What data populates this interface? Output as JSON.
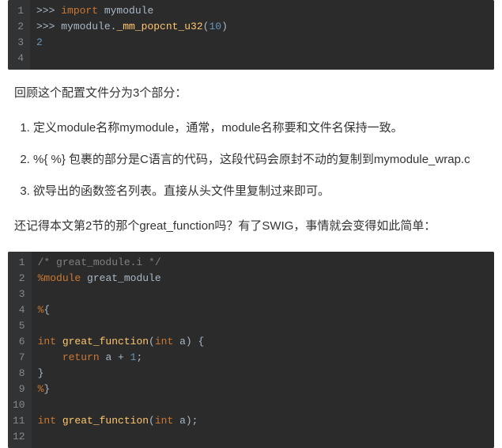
{
  "code_block_1": {
    "lines": [
      {
        "n": "1",
        "tokens": [
          {
            "t": ">>> ",
            "c": "tok-prompt"
          },
          {
            "t": "import",
            "c": "tok-kw"
          },
          {
            "t": " mymodule",
            "c": "tok-mod"
          }
        ]
      },
      {
        "n": "2",
        "tokens": [
          {
            "t": ">>> ",
            "c": "tok-prompt"
          },
          {
            "t": "mymodule.",
            "c": "tok-mod"
          },
          {
            "t": "_mm_popcnt_u32",
            "c": "tok-fn"
          },
          {
            "t": "(",
            "c": "tok-punct"
          },
          {
            "t": "10",
            "c": "tok-num"
          },
          {
            "t": ")",
            "c": "tok-punct"
          }
        ]
      },
      {
        "n": "3",
        "tokens": [
          {
            "t": "2",
            "c": "tok-out"
          }
        ]
      },
      {
        "n": "4",
        "tokens": []
      }
    ]
  },
  "para1": "回顾这个配置文件分为3个部分：",
  "list": {
    "items": [
      "定义module名称mymodule，通常，module名称要和文件名保持一致。",
      "%{ %} 包裹的部分是C语言的代码，这段代码会原封不动的复制到mymodule_wrap.c",
      "欲导出的函数签名列表。直接从头文件里复制过来即可。"
    ]
  },
  "para2": "还记得本文第2节的那个great_function吗？有了SWIG，事情就会变得如此简单：",
  "code_block_2": {
    "lines": [
      {
        "n": "1",
        "tokens": [
          {
            "t": "/* great_module.i */",
            "c": "tok-cmt"
          }
        ]
      },
      {
        "n": "2",
        "tokens": [
          {
            "t": "%",
            "c": "tok-op"
          },
          {
            "t": "module",
            "c": "tok-kw"
          },
          {
            "t": " great_module",
            "c": "tok-mod"
          }
        ]
      },
      {
        "n": "3",
        "tokens": []
      },
      {
        "n": "4",
        "tokens": [
          {
            "t": "%",
            "c": "tok-op"
          },
          {
            "t": "{",
            "c": "tok-punct"
          }
        ]
      },
      {
        "n": "5",
        "tokens": []
      },
      {
        "n": "6",
        "tokens": [
          {
            "t": "int",
            "c": "tok-type"
          },
          {
            "t": " ",
            "c": "tok-mod"
          },
          {
            "t": "great_function",
            "c": "tok-fn"
          },
          {
            "t": "(",
            "c": "tok-punct"
          },
          {
            "t": "int",
            "c": "tok-type"
          },
          {
            "t": " a) {",
            "c": "tok-punct"
          }
        ]
      },
      {
        "n": "7",
        "tokens": [
          {
            "t": "    ",
            "c": "tok-mod"
          },
          {
            "t": "return",
            "c": "tok-kw"
          },
          {
            "t": " a + ",
            "c": "tok-mod"
          },
          {
            "t": "1",
            "c": "tok-num"
          },
          {
            "t": ";",
            "c": "tok-punct"
          }
        ]
      },
      {
        "n": "8",
        "tokens": [
          {
            "t": "}",
            "c": "tok-punct"
          }
        ]
      },
      {
        "n": "9",
        "tokens": [
          {
            "t": "%",
            "c": "tok-op"
          },
          {
            "t": "}",
            "c": "tok-punct"
          }
        ]
      },
      {
        "n": "10",
        "tokens": []
      },
      {
        "n": "11",
        "tokens": [
          {
            "t": "int",
            "c": "tok-type"
          },
          {
            "t": " ",
            "c": "tok-mod"
          },
          {
            "t": "great_function",
            "c": "tok-fn"
          },
          {
            "t": "(",
            "c": "tok-punct"
          },
          {
            "t": "int",
            "c": "tok-type"
          },
          {
            "t": " a);",
            "c": "tok-punct"
          }
        ]
      },
      {
        "n": "12",
        "tokens": []
      }
    ]
  }
}
